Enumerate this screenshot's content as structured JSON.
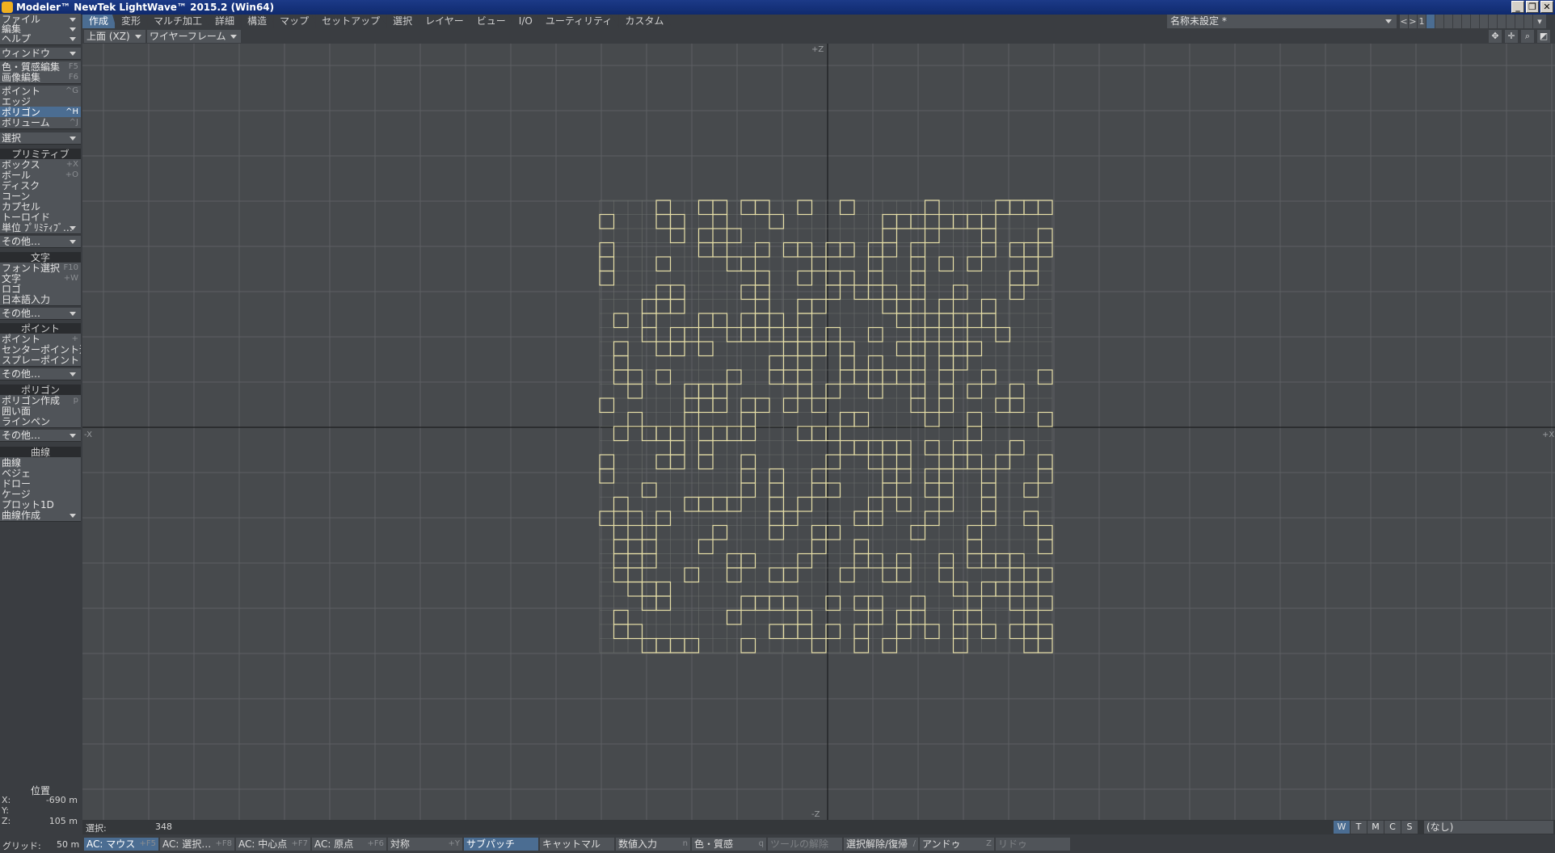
{
  "window": {
    "title": "Modeler™ NewTek LightWave™ 2015.2 (Win64)",
    "buttons": [
      "_",
      "❐",
      "✕"
    ]
  },
  "tabs": [
    "作成",
    "変形",
    "マルチ加工",
    "詳細",
    "構造",
    "マップ",
    "セットアップ",
    "選択",
    "レイヤー",
    "ビュー",
    "I/O",
    "ユーティリティ",
    "カスタム"
  ],
  "active_tab": "作成",
  "scene": {
    "name": "名称未設定 *",
    "layer_controls": [
      "<",
      ">",
      "1"
    ]
  },
  "left_menu": {
    "file": "ファイル",
    "edit": "編集",
    "help": "ヘルプ",
    "window": "ウィンドウ",
    "surface_edit": {
      "label": "色・質感編集",
      "sc": "F5"
    },
    "image_edit": {
      "label": "画像編集",
      "sc": "F6"
    },
    "modes": [
      {
        "label": "ポイント",
        "sc": "^G"
      },
      {
        "label": "エッジ",
        "sc": ""
      },
      {
        "label": "ポリゴン",
        "sc": "^H"
      },
      {
        "label": "ボリューム",
        "sc": "^J"
      }
    ],
    "selected_mode": "ポリゴン",
    "select_dd": "選択",
    "sections": {
      "primitives": {
        "title": "プリミティブ",
        "items": [
          {
            "label": "ボックス",
            "sc": "+X"
          },
          {
            "label": "ボール",
            "sc": "+O"
          },
          {
            "label": "ディスク",
            "sc": ""
          },
          {
            "label": "コーン",
            "sc": ""
          },
          {
            "label": "カプセル",
            "sc": ""
          },
          {
            "label": "トーロイド",
            "sc": ""
          },
          {
            "label": "単位 ﾌﾟﾘﾐﾃｨﾌﾞ…",
            "sc": ""
          }
        ],
        "more": "その他…"
      },
      "text": {
        "title": "文字",
        "items": [
          {
            "label": "フォント選択",
            "sc": "F10"
          },
          {
            "label": "文字",
            "sc": "+W"
          },
          {
            "label": "ロゴ",
            "sc": ""
          },
          {
            "label": "日本語入力",
            "sc": ""
          }
        ],
        "more": "その他…"
      },
      "points": {
        "title": "ポイント",
        "items": [
          {
            "label": "ポイント",
            "sc": "+"
          },
          {
            "label": "センターポイント追加",
            "sc": ""
          },
          {
            "label": "スプレーポイント",
            "sc": ""
          }
        ],
        "more": "その他…"
      },
      "polygons": {
        "title": "ポリゴン",
        "items": [
          {
            "label": "ポリゴン作成",
            "sc": "p"
          },
          {
            "label": "囲い面",
            "sc": ""
          },
          {
            "label": "ラインペン",
            "sc": ""
          }
        ],
        "more": "その他…"
      },
      "curves": {
        "title": "曲線",
        "items": [
          {
            "label": "曲線",
            "sc": ""
          },
          {
            "label": "ベジェ",
            "sc": ""
          },
          {
            "label": "ドロー",
            "sc": ""
          },
          {
            "label": "ケージ",
            "sc": ""
          },
          {
            "label": "プロット1D",
            "sc": ""
          }
        ],
        "more": "曲線作成"
      }
    }
  },
  "view": {
    "projection": "上面 (XZ)",
    "render_mode": "ワイヤーフレーム",
    "axis_labels": {
      "top": "+Z",
      "bottom": "-Z",
      "left": "-X",
      "right": "+X"
    },
    "grid_color": "#5c5f62",
    "axis_color": "#1c1d1f",
    "wire_color": "#e8e0a8",
    "point_color": "#c8c4b0"
  },
  "position": {
    "title": "位置",
    "x_label": "X:",
    "x_value": "-690 m",
    "y_label": "Y:",
    "y_value": "",
    "z_label": "Z:",
    "z_value": "105 m"
  },
  "status": {
    "selection_label": "選択:",
    "selection_count": "348",
    "wtmcs": [
      "W",
      "T",
      "M",
      "C",
      "S"
    ],
    "surface_dd": "(なし)",
    "grid_label": "グリッド:",
    "grid_value": "50 m",
    "buttons": [
      {
        "label": "AC: マウス",
        "sc": "+F5",
        "on": true
      },
      {
        "label": "AC: 選択…",
        "sc": "+F8"
      },
      {
        "label": "AC: 中心点",
        "sc": "+F7"
      },
      {
        "label": "AC: 原点",
        "sc": "+F6"
      },
      {
        "label": "対称",
        "sc": "+Y"
      },
      {
        "label": "サブパッチ",
        "sc": "",
        "on": true
      },
      {
        "label": "キャットマル",
        "sc": ""
      },
      {
        "label": "数値入力",
        "sc": "n"
      },
      {
        "label": "色・質感",
        "sc": "q"
      },
      {
        "label": "ツールの解除",
        "sc": "",
        "dis": true
      },
      {
        "label": "選択解除/復帰",
        "sc": "/"
      },
      {
        "label": "アンドゥ",
        "sc": "Z"
      },
      {
        "label": "リドゥ",
        "sc": "",
        "dis": true
      }
    ]
  }
}
